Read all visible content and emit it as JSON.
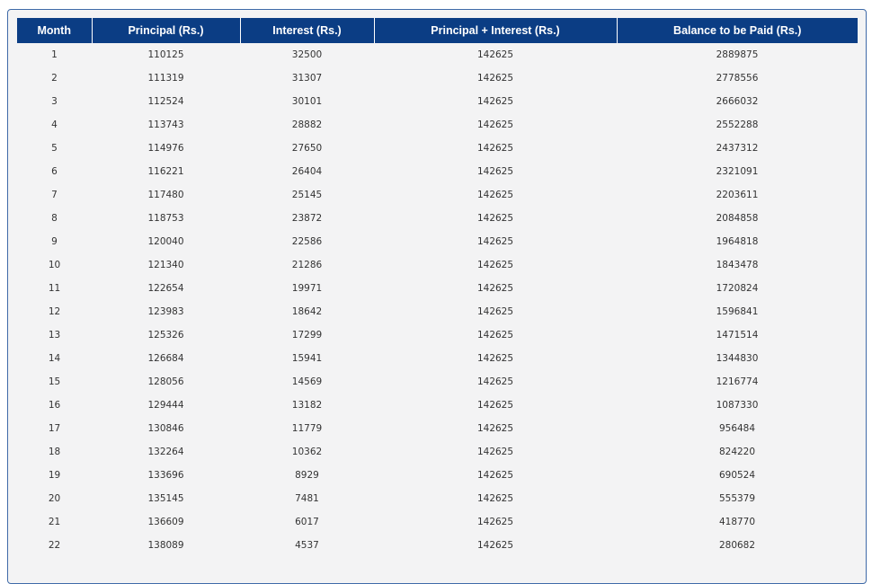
{
  "table": {
    "headers": [
      "Month",
      "Principal (Rs.)",
      "Interest (Rs.)",
      "Principal + Interest (Rs.)",
      "Balance to be Paid (Rs.)"
    ],
    "rows": [
      [
        "1",
        "110125",
        "32500",
        "142625",
        "2889875"
      ],
      [
        "2",
        "111319",
        "31307",
        "142625",
        "2778556"
      ],
      [
        "3",
        "112524",
        "30101",
        "142625",
        "2666032"
      ],
      [
        "4",
        "113743",
        "28882",
        "142625",
        "2552288"
      ],
      [
        "5",
        "114976",
        "27650",
        "142625",
        "2437312"
      ],
      [
        "6",
        "116221",
        "26404",
        "142625",
        "2321091"
      ],
      [
        "7",
        "117480",
        "25145",
        "142625",
        "2203611"
      ],
      [
        "8",
        "118753",
        "23872",
        "142625",
        "2084858"
      ],
      [
        "9",
        "120040",
        "22586",
        "142625",
        "1964818"
      ],
      [
        "10",
        "121340",
        "21286",
        "142625",
        "1843478"
      ],
      [
        "11",
        "122654",
        "19971",
        "142625",
        "1720824"
      ],
      [
        "12",
        "123983",
        "18642",
        "142625",
        "1596841"
      ],
      [
        "13",
        "125326",
        "17299",
        "142625",
        "1471514"
      ],
      [
        "14",
        "126684",
        "15941",
        "142625",
        "1344830"
      ],
      [
        "15",
        "128056",
        "14569",
        "142625",
        "1216774"
      ],
      [
        "16",
        "129444",
        "13182",
        "142625",
        "1087330"
      ],
      [
        "17",
        "130846",
        "11779",
        "142625",
        "956484"
      ],
      [
        "18",
        "132264",
        "10362",
        "142625",
        "824220"
      ],
      [
        "19",
        "133696",
        "8929",
        "142625",
        "690524"
      ],
      [
        "20",
        "135145",
        "7481",
        "142625",
        "555379"
      ],
      [
        "21",
        "136609",
        "6017",
        "142625",
        "418770"
      ],
      [
        "22",
        "138089",
        "4537",
        "142625",
        "280682"
      ]
    ]
  },
  "colors": {
    "header_bg": "#0b3d84",
    "header_text": "#ffffff",
    "panel_bg": "#f3f3f4",
    "panel_border": "#3f6aa8",
    "cell_text": "#333333"
  }
}
